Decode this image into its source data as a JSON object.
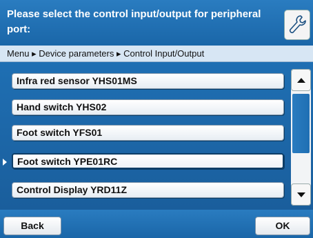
{
  "header": {
    "title": "Please select the control input/output for peripheral port:",
    "tool_icon": "wrench-icon"
  },
  "breadcrumb": {
    "text": "Menu ▸ Device parameters ▸ Control Input/Output"
  },
  "list": {
    "items": [
      {
        "label": "Infra red sensor YHS01MS",
        "selected": false
      },
      {
        "label": "Hand switch YHS02",
        "selected": false
      },
      {
        "label": "Foot switch YFS01",
        "selected": false
      },
      {
        "label": "Foot switch YPE01RC",
        "selected": true
      },
      {
        "label": "Control Display YRD11Z",
        "selected": false
      }
    ]
  },
  "scrollbar": {
    "up_icon": "arrow-up-icon",
    "down_icon": "arrow-down-icon"
  },
  "footer": {
    "back_label": "Back",
    "ok_label": "OK"
  }
}
